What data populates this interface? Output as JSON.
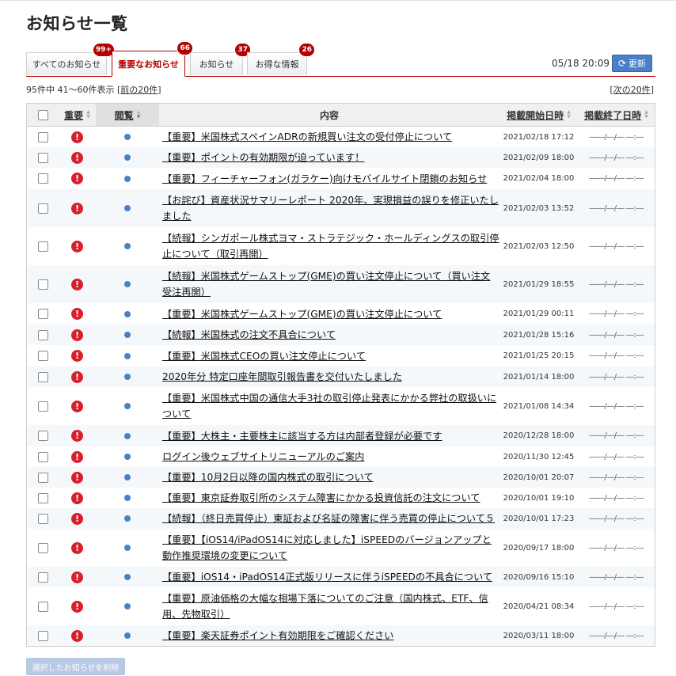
{
  "page": {
    "title": "お知らせ一覧"
  },
  "tabs": [
    {
      "label": "すべてのお知らせ",
      "badge": "99+",
      "active": false
    },
    {
      "label": "重要なお知らせ",
      "badge": "66",
      "active": true
    },
    {
      "label": "お知らせ",
      "badge": "37",
      "active": false
    },
    {
      "label": "お得な情報",
      "badge": "26",
      "active": false
    }
  ],
  "header": {
    "timestamp": "05/18 20:09",
    "refresh_label": "更新"
  },
  "pagination": {
    "total": "95件中",
    "range": "41～60件表示",
    "prev_label": "前の20件",
    "next_label": "次の20件"
  },
  "table": {
    "columns": {
      "important": "重要",
      "read": "閲覧",
      "content": "内容",
      "start": "掲載開始日時",
      "end": "掲載終了日時"
    },
    "rows": [
      {
        "title": "【重要】米国株式スペインADRの新規買い注文の受付停止について",
        "start": "2021/02/18 17:12",
        "end": "――/―/― ―:―"
      },
      {
        "title": "【重要】ポイントの有効期限が迫っています！",
        "start": "2021/02/09 18:00",
        "end": "――/―/― ―:―"
      },
      {
        "title": "【重要】フィーチャーフォン(ガラケー)向けモバイルサイト閉鎖のお知らせ",
        "start": "2021/02/04 18:00",
        "end": "――/―/― ―:―"
      },
      {
        "title": "【お詫び】資産状況サマリーレポート 2020年、実現損益の誤りを修正いたしました",
        "start": "2021/02/03 13:52",
        "end": "――/―/― ―:―"
      },
      {
        "title": "【続報】シンガポール株式ヨマ・ストラテジック・ホールディングスの取引停止について（取引再開）",
        "start": "2021/02/03 12:50",
        "end": "――/―/― ―:―"
      },
      {
        "title": "【続報】米国株式ゲームストップ(GME)の買い注文停止について（買い注文受注再開）",
        "start": "2021/01/29 18:55",
        "end": "――/―/― ―:―"
      },
      {
        "title": "【重要】米国株式ゲームストップ(GME)の買い注文停止について",
        "start": "2021/01/29 00:11",
        "end": "――/―/― ―:―"
      },
      {
        "title": "【続報】米国株式の注文不具合について",
        "start": "2021/01/28 15:16",
        "end": "――/―/― ―:―"
      },
      {
        "title": "【重要】米国株式CEOの買い注文停止について",
        "start": "2021/01/25 20:15",
        "end": "――/―/― ―:―"
      },
      {
        "title": "2020年分 特定口座年間取引報告書を交付いたしました",
        "start": "2021/01/14 18:00",
        "end": "――/―/― ―:―"
      },
      {
        "title": "【重要】米国株式中国の通信大手3社の取引停止発表にかかる弊社の取扱いについて",
        "start": "2021/01/08 14:34",
        "end": "――/―/― ―:―"
      },
      {
        "title": "【重要】大株主・主要株主に該当する方は内部者登録が必要です",
        "start": "2020/12/28 18:00",
        "end": "――/―/― ―:―"
      },
      {
        "title": "ログイン後ウェブサイトリニューアルのご案内",
        "start": "2020/11/30 12:45",
        "end": "――/―/― ―:―"
      },
      {
        "title": "【重要】10月2日以降の国内株式の取引について",
        "start": "2020/10/01 20:07",
        "end": "――/―/― ―:―"
      },
      {
        "title": "【重要】東京証券取引所のシステム障害にかかる投資信託の注文について",
        "start": "2020/10/01 19:10",
        "end": "――/―/― ―:―"
      },
      {
        "title": "【続報】（終日売買停止）東証および名証の障害に伴う売買の停止について５",
        "start": "2020/10/01 17:23",
        "end": "――/―/― ―:―"
      },
      {
        "title": "【重要】【iOS14/iPadOS14に対応しました】iSPEEDのバージョンアップと動作推奨環境の変更について",
        "start": "2020/09/17 18:00",
        "end": "――/―/― ―:―"
      },
      {
        "title": "【重要】iOS14・iPadOS14正式版リリースに伴うiSPEEDの不具合について",
        "start": "2020/09/16 15:10",
        "end": "――/―/― ―:―"
      },
      {
        "title": "【重要】原油価格の大幅な相場下落についてのご注意（国内株式、ETF、信用、先物取引）",
        "start": "2020/04/21 08:34",
        "end": "――/―/― ―:―"
      },
      {
        "title": "【重要】楽天証券ポイント有効期限をご確認ください",
        "start": "2020/03/11 18:00",
        "end": "――/―/― ―:―"
      }
    ]
  },
  "footer": {
    "delete_label": "選択したお知らせを削除"
  },
  "colors": {
    "accent_red": "#b30000",
    "button_blue": "#4a7fc9",
    "important_red": "#d8202c"
  }
}
